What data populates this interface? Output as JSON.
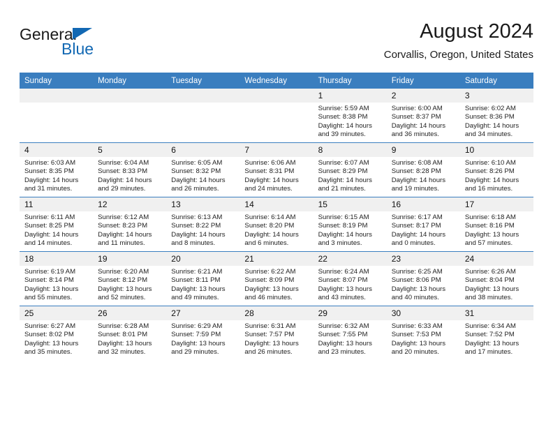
{
  "brand": {
    "name_top": "General",
    "name_bottom": "Blue",
    "triangle_color": "#1268b3"
  },
  "header": {
    "title": "August 2024",
    "subtitle": "Corvallis, Oregon, United States"
  },
  "colors": {
    "header_blue": "#3a7ebf",
    "daynum_band": "#f0f0f0",
    "brand_blue": "#1268b3"
  },
  "weekday_headers": [
    "Sunday",
    "Monday",
    "Tuesday",
    "Wednesday",
    "Thursday",
    "Friday",
    "Saturday"
  ],
  "labels": {
    "sunrise": "Sunrise:",
    "sunset": "Sunset:",
    "daylight": "Daylight:"
  },
  "weeks": [
    [
      {
        "day": "",
        "blank": true,
        "sunrise": "",
        "sunset": "",
        "daylight": ""
      },
      {
        "day": "",
        "blank": true,
        "sunrise": "",
        "sunset": "",
        "daylight": ""
      },
      {
        "day": "",
        "blank": true,
        "sunrise": "",
        "sunset": "",
        "daylight": ""
      },
      {
        "day": "",
        "blank": true,
        "sunrise": "",
        "sunset": "",
        "daylight": ""
      },
      {
        "day": "1",
        "blank": false,
        "sunrise": "Sunrise: 5:59 AM",
        "sunset": "Sunset: 8:38 PM",
        "daylight": "Daylight: 14 hours and 39 minutes."
      },
      {
        "day": "2",
        "blank": false,
        "sunrise": "Sunrise: 6:00 AM",
        "sunset": "Sunset: 8:37 PM",
        "daylight": "Daylight: 14 hours and 36 minutes."
      },
      {
        "day": "3",
        "blank": false,
        "sunrise": "Sunrise: 6:02 AM",
        "sunset": "Sunset: 8:36 PM",
        "daylight": "Daylight: 14 hours and 34 minutes."
      }
    ],
    [
      {
        "day": "4",
        "blank": false,
        "sunrise": "Sunrise: 6:03 AM",
        "sunset": "Sunset: 8:35 PM",
        "daylight": "Daylight: 14 hours and 31 minutes."
      },
      {
        "day": "5",
        "blank": false,
        "sunrise": "Sunrise: 6:04 AM",
        "sunset": "Sunset: 8:33 PM",
        "daylight": "Daylight: 14 hours and 29 minutes."
      },
      {
        "day": "6",
        "blank": false,
        "sunrise": "Sunrise: 6:05 AM",
        "sunset": "Sunset: 8:32 PM",
        "daylight": "Daylight: 14 hours and 26 minutes."
      },
      {
        "day": "7",
        "blank": false,
        "sunrise": "Sunrise: 6:06 AM",
        "sunset": "Sunset: 8:31 PM",
        "daylight": "Daylight: 14 hours and 24 minutes."
      },
      {
        "day": "8",
        "blank": false,
        "sunrise": "Sunrise: 6:07 AM",
        "sunset": "Sunset: 8:29 PM",
        "daylight": "Daylight: 14 hours and 21 minutes."
      },
      {
        "day": "9",
        "blank": false,
        "sunrise": "Sunrise: 6:08 AM",
        "sunset": "Sunset: 8:28 PM",
        "daylight": "Daylight: 14 hours and 19 minutes."
      },
      {
        "day": "10",
        "blank": false,
        "sunrise": "Sunrise: 6:10 AM",
        "sunset": "Sunset: 8:26 PM",
        "daylight": "Daylight: 14 hours and 16 minutes."
      }
    ],
    [
      {
        "day": "11",
        "blank": false,
        "sunrise": "Sunrise: 6:11 AM",
        "sunset": "Sunset: 8:25 PM",
        "daylight": "Daylight: 14 hours and 14 minutes."
      },
      {
        "day": "12",
        "blank": false,
        "sunrise": "Sunrise: 6:12 AM",
        "sunset": "Sunset: 8:23 PM",
        "daylight": "Daylight: 14 hours and 11 minutes."
      },
      {
        "day": "13",
        "blank": false,
        "sunrise": "Sunrise: 6:13 AM",
        "sunset": "Sunset: 8:22 PM",
        "daylight": "Daylight: 14 hours and 8 minutes."
      },
      {
        "day": "14",
        "blank": false,
        "sunrise": "Sunrise: 6:14 AM",
        "sunset": "Sunset: 8:20 PM",
        "daylight": "Daylight: 14 hours and 6 minutes."
      },
      {
        "day": "15",
        "blank": false,
        "sunrise": "Sunrise: 6:15 AM",
        "sunset": "Sunset: 8:19 PM",
        "daylight": "Daylight: 14 hours and 3 minutes."
      },
      {
        "day": "16",
        "blank": false,
        "sunrise": "Sunrise: 6:17 AM",
        "sunset": "Sunset: 8:17 PM",
        "daylight": "Daylight: 14 hours and 0 minutes."
      },
      {
        "day": "17",
        "blank": false,
        "sunrise": "Sunrise: 6:18 AM",
        "sunset": "Sunset: 8:16 PM",
        "daylight": "Daylight: 13 hours and 57 minutes."
      }
    ],
    [
      {
        "day": "18",
        "blank": false,
        "sunrise": "Sunrise: 6:19 AM",
        "sunset": "Sunset: 8:14 PM",
        "daylight": "Daylight: 13 hours and 55 minutes."
      },
      {
        "day": "19",
        "blank": false,
        "sunrise": "Sunrise: 6:20 AM",
        "sunset": "Sunset: 8:12 PM",
        "daylight": "Daylight: 13 hours and 52 minutes."
      },
      {
        "day": "20",
        "blank": false,
        "sunrise": "Sunrise: 6:21 AM",
        "sunset": "Sunset: 8:11 PM",
        "daylight": "Daylight: 13 hours and 49 minutes."
      },
      {
        "day": "21",
        "blank": false,
        "sunrise": "Sunrise: 6:22 AM",
        "sunset": "Sunset: 8:09 PM",
        "daylight": "Daylight: 13 hours and 46 minutes."
      },
      {
        "day": "22",
        "blank": false,
        "sunrise": "Sunrise: 6:24 AM",
        "sunset": "Sunset: 8:07 PM",
        "daylight": "Daylight: 13 hours and 43 minutes."
      },
      {
        "day": "23",
        "blank": false,
        "sunrise": "Sunrise: 6:25 AM",
        "sunset": "Sunset: 8:06 PM",
        "daylight": "Daylight: 13 hours and 40 minutes."
      },
      {
        "day": "24",
        "blank": false,
        "sunrise": "Sunrise: 6:26 AM",
        "sunset": "Sunset: 8:04 PM",
        "daylight": "Daylight: 13 hours and 38 minutes."
      }
    ],
    [
      {
        "day": "25",
        "blank": false,
        "sunrise": "Sunrise: 6:27 AM",
        "sunset": "Sunset: 8:02 PM",
        "daylight": "Daylight: 13 hours and 35 minutes."
      },
      {
        "day": "26",
        "blank": false,
        "sunrise": "Sunrise: 6:28 AM",
        "sunset": "Sunset: 8:01 PM",
        "daylight": "Daylight: 13 hours and 32 minutes."
      },
      {
        "day": "27",
        "blank": false,
        "sunrise": "Sunrise: 6:29 AM",
        "sunset": "Sunset: 7:59 PM",
        "daylight": "Daylight: 13 hours and 29 minutes."
      },
      {
        "day": "28",
        "blank": false,
        "sunrise": "Sunrise: 6:31 AM",
        "sunset": "Sunset: 7:57 PM",
        "daylight": "Daylight: 13 hours and 26 minutes."
      },
      {
        "day": "29",
        "blank": false,
        "sunrise": "Sunrise: 6:32 AM",
        "sunset": "Sunset: 7:55 PM",
        "daylight": "Daylight: 13 hours and 23 minutes."
      },
      {
        "day": "30",
        "blank": false,
        "sunrise": "Sunrise: 6:33 AM",
        "sunset": "Sunset: 7:53 PM",
        "daylight": "Daylight: 13 hours and 20 minutes."
      },
      {
        "day": "31",
        "blank": false,
        "sunrise": "Sunrise: 6:34 AM",
        "sunset": "Sunset: 7:52 PM",
        "daylight": "Daylight: 13 hours and 17 minutes."
      }
    ]
  ]
}
